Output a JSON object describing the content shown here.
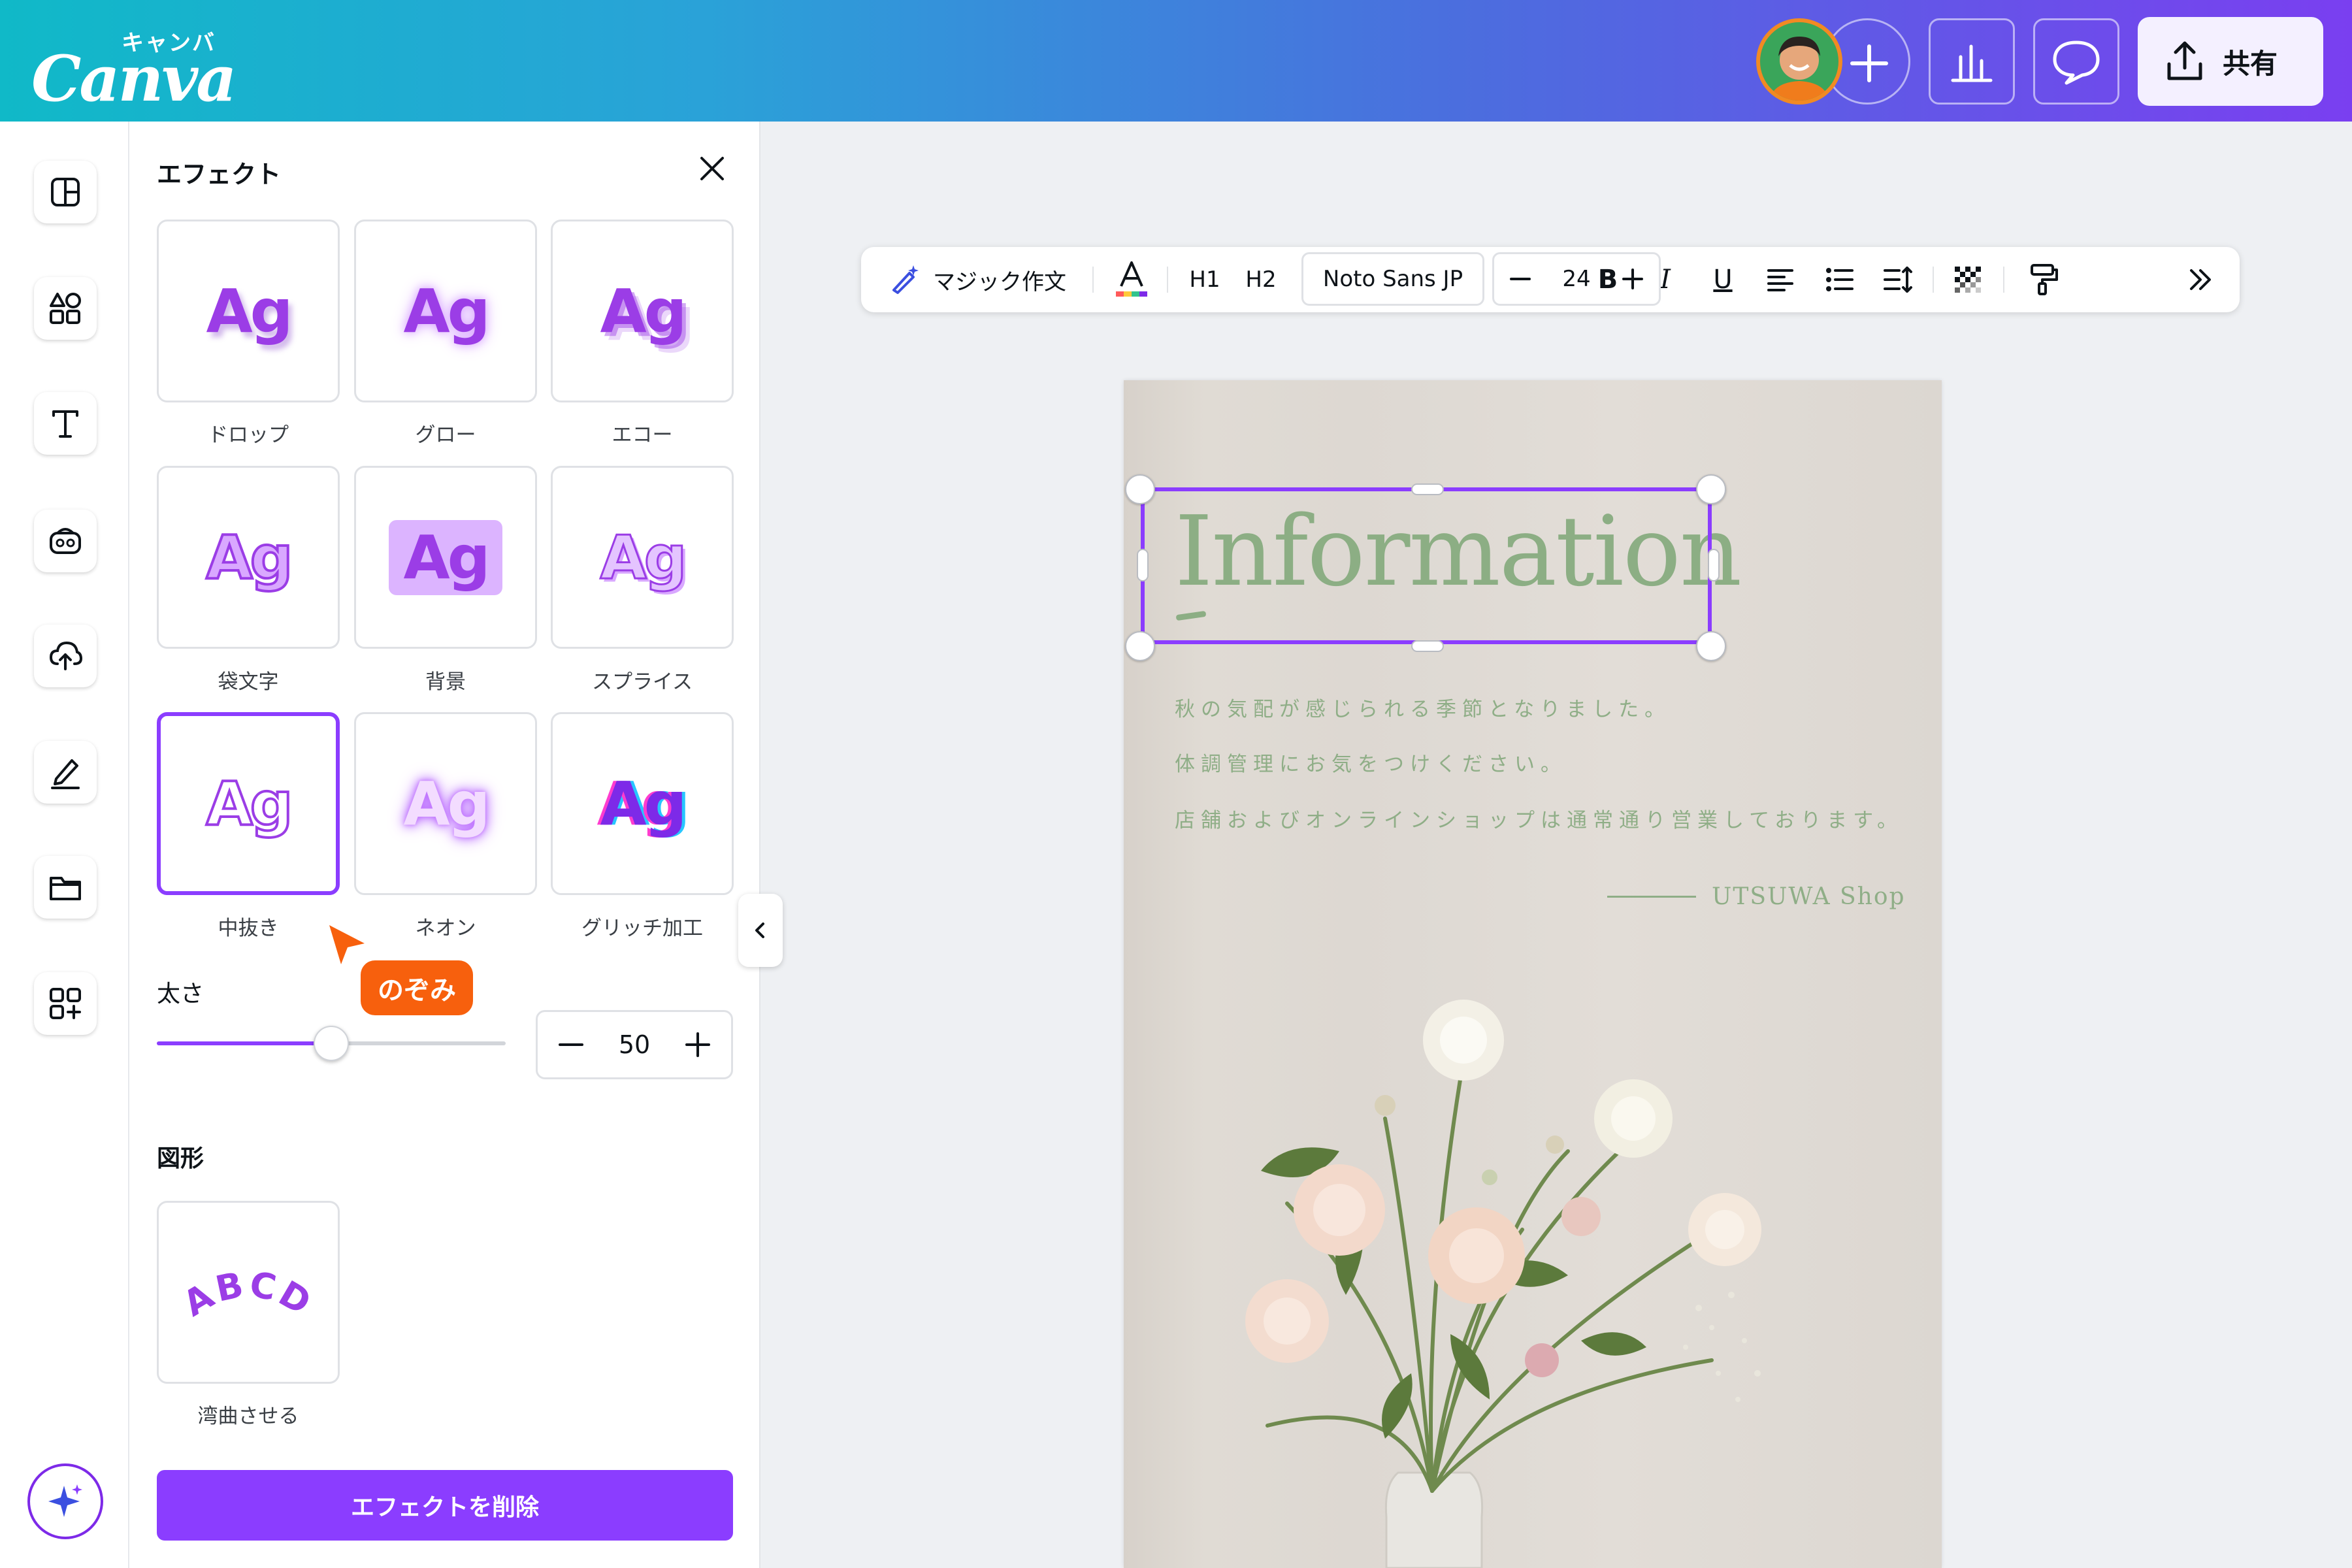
{
  "header": {
    "logo_kana": "キャンバ",
    "logo_word": "Canva",
    "share_label": "共有",
    "icons": [
      "avatar",
      "plus-icon",
      "insights-icon",
      "comment-icon",
      "share-upload-icon"
    ]
  },
  "rail": {
    "icons": [
      "design-icon",
      "elements-icon",
      "text-icon",
      "brand-icon",
      "uploads-icon",
      "draw-icon",
      "projects-icon",
      "apps-icon",
      "magic-icon"
    ]
  },
  "panel": {
    "title": "エフェクト",
    "effects": [
      {
        "label": "ドロップ",
        "sample": "Ag"
      },
      {
        "label": "グロー",
        "sample": "Ag"
      },
      {
        "label": "エコー",
        "sample": "Ag"
      },
      {
        "label": "袋文字",
        "sample": "Ag"
      },
      {
        "label": "背景",
        "sample": "Ag"
      },
      {
        "label": "スプライス",
        "sample": "Ag"
      },
      {
        "label": "中抜き",
        "sample": "Ag",
        "selected": true
      },
      {
        "label": "ネオン",
        "sample": "Ag"
      },
      {
        "label": "グリッチ加工",
        "sample": "Ag"
      }
    ],
    "thickness_label": "太さ",
    "thickness_value": "50",
    "thickness_fraction": 0.5,
    "shape_title": "図形",
    "shape_label": "湾曲させる",
    "shape_sample": "ABCD",
    "delete_label": "エフェクトを削除"
  },
  "collaborator": {
    "name": "のぞみ",
    "color": "#f7600d"
  },
  "toolbar": {
    "magic_write": "マジック作文",
    "h1": "H1",
    "h2": "H2",
    "font": "Noto Sans JP",
    "size": "24",
    "bold": "B",
    "italic": "I",
    "underline": "U"
  },
  "page": {
    "title": "Information",
    "lines": [
      "秋の気配が感じられる季節となりました。",
      "体調管理にお気をつけください。",
      "店舗およびオンラインショップは通常通り営業しております。"
    ],
    "signature": "UTSUWA Shop"
  },
  "colors": {
    "accent": "#8b3dff",
    "title_green": "#8cae84",
    "orange": "#f7600d"
  }
}
